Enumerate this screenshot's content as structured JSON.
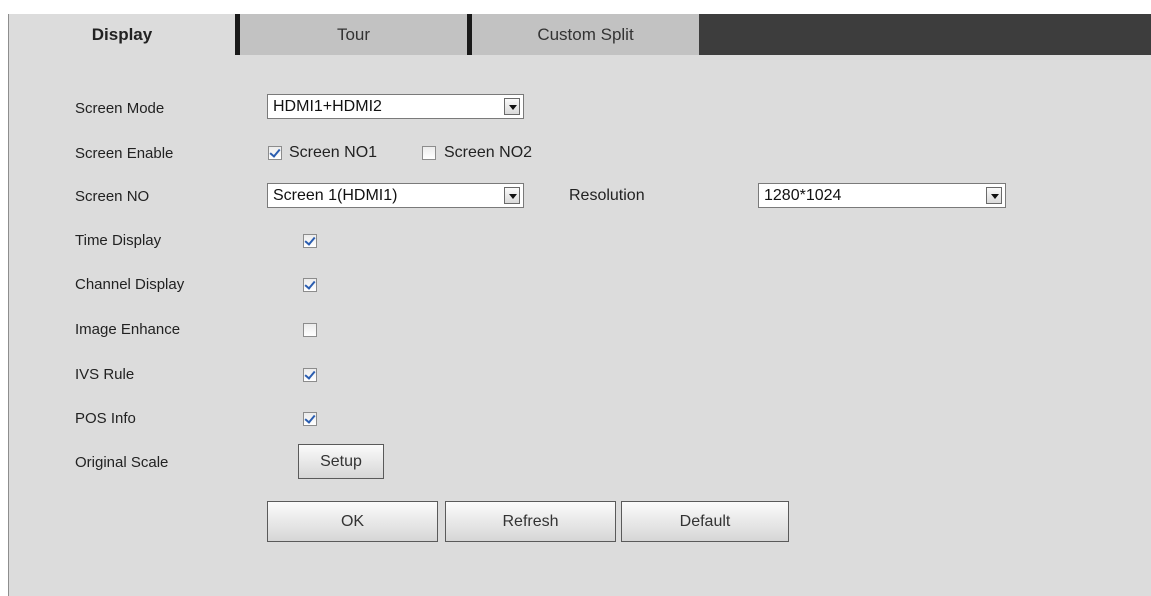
{
  "tabs": {
    "display": "Display",
    "tour": "Tour",
    "custom_split": "Custom Split"
  },
  "form": {
    "screen_mode": {
      "label": "Screen Mode",
      "value": "HDMI1+HDMI2"
    },
    "screen_enable": {
      "label": "Screen Enable",
      "screen1": {
        "label": "Screen NO1",
        "checked": true
      },
      "screen2": {
        "label": "Screen NO2",
        "checked": false
      }
    },
    "screen_no": {
      "label": "Screen NO",
      "value": "Screen 1(HDMI1)"
    },
    "resolution": {
      "label": "Resolution",
      "value": "1280*1024"
    },
    "time_display": {
      "label": "Time Display",
      "checked": true
    },
    "channel_display": {
      "label": "Channel Display",
      "checked": true
    },
    "image_enhance": {
      "label": "Image Enhance",
      "checked": false
    },
    "ivs_rule": {
      "label": "IVS Rule",
      "checked": true
    },
    "pos_info": {
      "label": "POS Info",
      "checked": true
    },
    "original_scale": {
      "label": "Original Scale",
      "button": "Setup"
    }
  },
  "actions": {
    "ok": "OK",
    "refresh": "Refresh",
    "default": "Default"
  },
  "colors": {
    "panel_bg": "#dcdcdc",
    "tabbar_bg": "#3d3d3d",
    "inactive_tab": "#c2c2c2",
    "check_mark": "#2a5db0"
  }
}
